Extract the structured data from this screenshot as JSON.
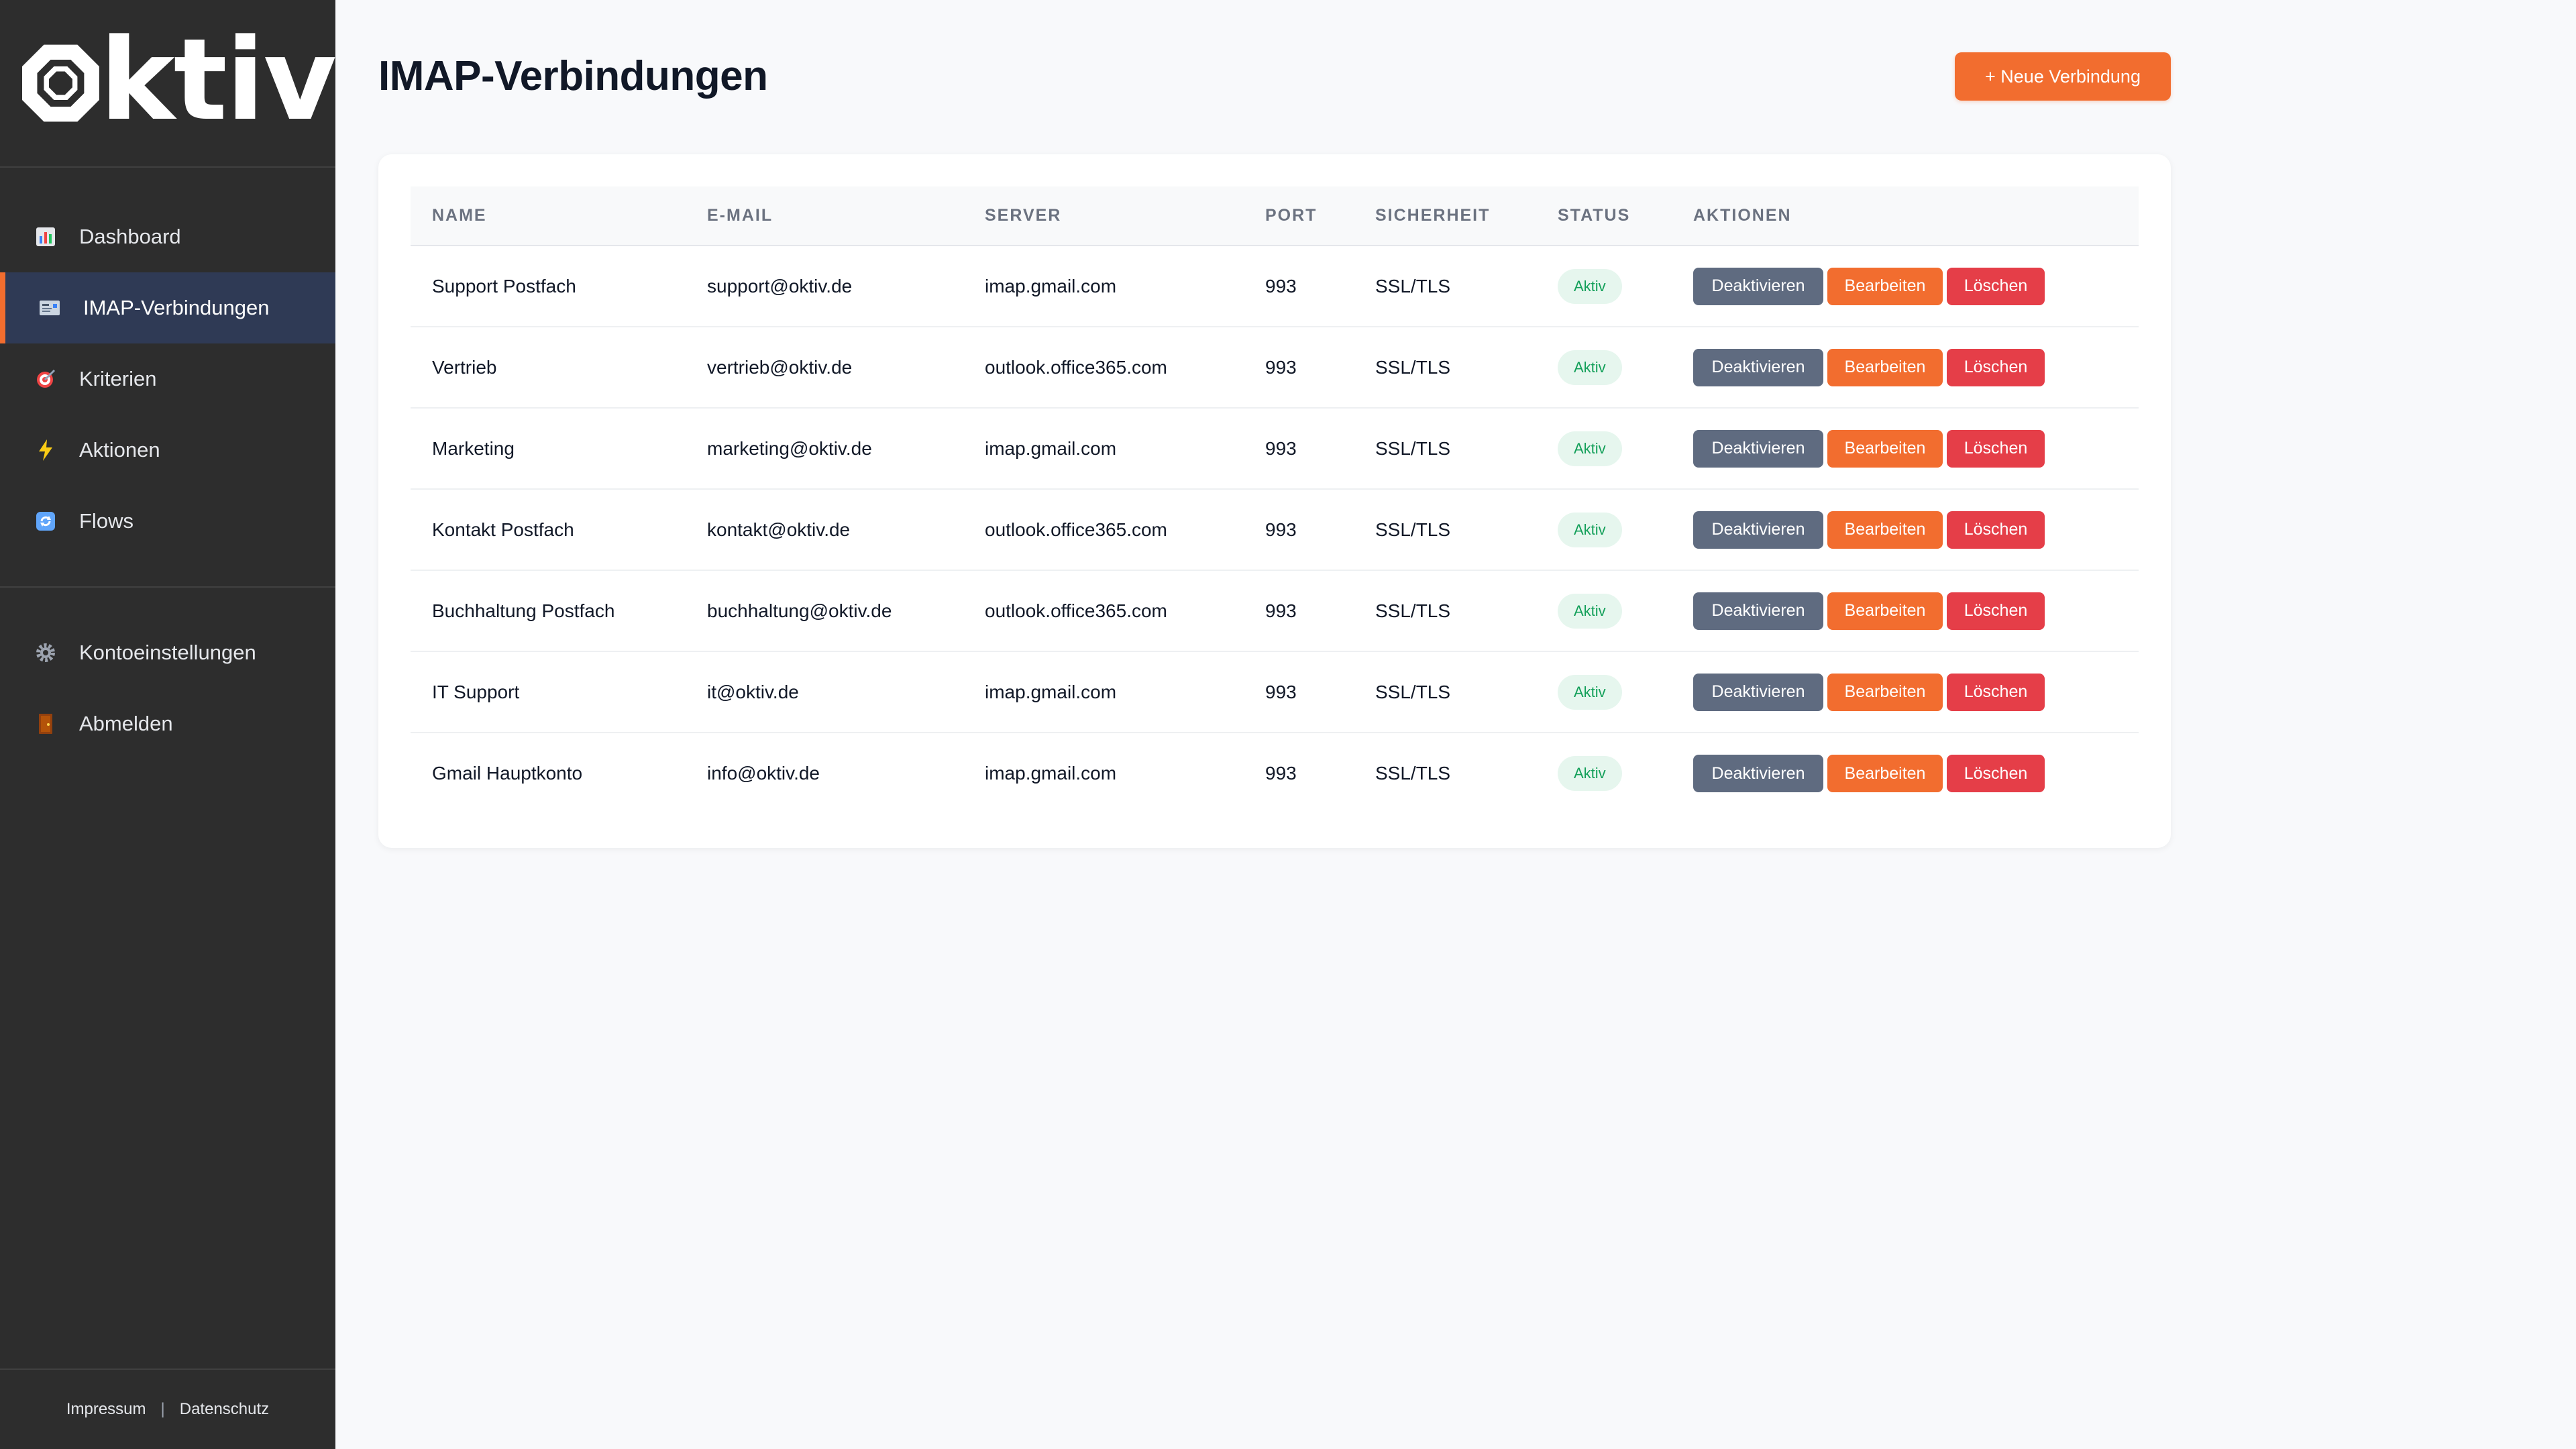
{
  "brand": {
    "logo_text": "ktiv",
    "accent": "#f26d2f",
    "sidebar_bg": "#2d2d2d"
  },
  "sidebar": {
    "items": [
      {
        "label": "Dashboard",
        "icon": "bar-chart-icon"
      },
      {
        "label": "IMAP-Verbindungen",
        "icon": "envelope-card-icon",
        "active": true
      },
      {
        "label": "Kriterien",
        "icon": "target-icon"
      },
      {
        "label": "Aktionen",
        "icon": "lightning-icon"
      },
      {
        "label": "Flows",
        "icon": "refresh-icon"
      }
    ],
    "secondary": [
      {
        "label": "Kontoeinstellungen",
        "icon": "gear-icon"
      },
      {
        "label": "Abmelden",
        "icon": "door-icon"
      }
    ],
    "footer": {
      "impressum": "Impressum",
      "separator": "|",
      "datenschutz": "Datenschutz"
    }
  },
  "page": {
    "title": "IMAP-Verbindungen",
    "new_button": "+ Neue Verbindung"
  },
  "table": {
    "columns": [
      "NAME",
      "E-MAIL",
      "SERVER",
      "PORT",
      "SICHERHEIT",
      "STATUS",
      "AKTIONEN"
    ],
    "rows": [
      {
        "name": "Support Postfach",
        "email": "support@oktiv.de",
        "server": "imap.gmail.com",
        "port": "993",
        "security": "SSL/TLS",
        "status": "Aktiv"
      },
      {
        "name": "Vertrieb",
        "email": "vertrieb@oktiv.de",
        "server": "outlook.office365.com",
        "port": "993",
        "security": "SSL/TLS",
        "status": "Aktiv"
      },
      {
        "name": "Marketing",
        "email": "marketing@oktiv.de",
        "server": "imap.gmail.com",
        "port": "993",
        "security": "SSL/TLS",
        "status": "Aktiv"
      },
      {
        "name": "Kontakt Postfach",
        "email": "kontakt@oktiv.de",
        "server": "outlook.office365.com",
        "port": "993",
        "security": "SSL/TLS",
        "status": "Aktiv"
      },
      {
        "name": "Buchhaltung Postfach",
        "email": "buchhaltung@oktiv.de",
        "server": "outlook.office365.com",
        "port": "993",
        "security": "SSL/TLS",
        "status": "Aktiv"
      },
      {
        "name": "IT Support",
        "email": "it@oktiv.de",
        "server": "imap.gmail.com",
        "port": "993",
        "security": "SSL/TLS",
        "status": "Aktiv"
      },
      {
        "name": "Gmail Hauptkonto",
        "email": "info@oktiv.de",
        "server": "imap.gmail.com",
        "port": "993",
        "security": "SSL/TLS",
        "status": "Aktiv"
      }
    ],
    "actions": {
      "deactivate": "Deaktivieren",
      "edit": "Bearbeiten",
      "delete": "Löschen"
    },
    "colors": {
      "deactivate": "#5f6b80",
      "edit": "#f26d2f",
      "delete": "#e53e48",
      "status": "#14a05a"
    }
  }
}
